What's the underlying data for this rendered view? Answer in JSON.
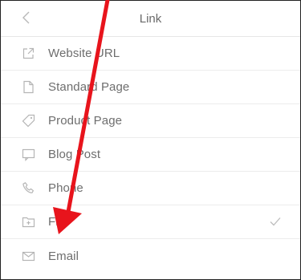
{
  "header": {
    "title": "Link",
    "back_icon": "chevron-left-icon"
  },
  "items": [
    {
      "label": "Website URL",
      "icon": "external-link-icon",
      "selected": false
    },
    {
      "label": "Standard Page",
      "icon": "page-icon",
      "selected": false
    },
    {
      "label": "Product Page",
      "icon": "tag-icon",
      "selected": false
    },
    {
      "label": "Blog Post",
      "icon": "blog-post-icon",
      "selected": false
    },
    {
      "label": "Phone",
      "icon": "phone-icon",
      "selected": false
    },
    {
      "label": "File",
      "icon": "folder-icon",
      "selected": true
    },
    {
      "label": "Email",
      "icon": "envelope-icon",
      "selected": false
    }
  ],
  "colors": {
    "annotation_arrow": "#e8141c",
    "icon_gray": "#b5b5b5",
    "text": "#6e6e6e"
  }
}
